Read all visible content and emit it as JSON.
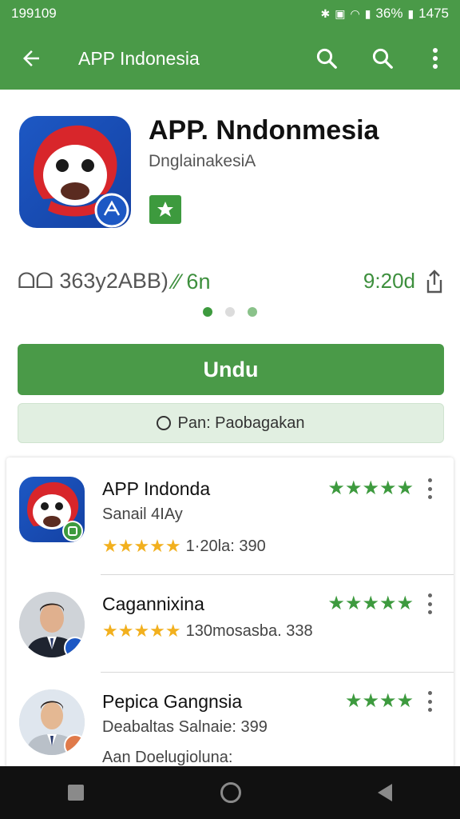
{
  "status_bar": {
    "time": "199109",
    "battery": "36%",
    "clock": "1475"
  },
  "app_bar": {
    "title": "APP Indonesia"
  },
  "app": {
    "name": "APP. Nndonmesia",
    "developer": "DnglainakesiA",
    "meta_left": "ᗝᗝ 363y2ABB)",
    "meta_green": "⁄⁄ 6n",
    "meta_right": "9:20d",
    "install_label": "Undu",
    "secondary_label": "Pan: Paobagakan"
  },
  "carousel": {
    "count": 3,
    "active": 0
  },
  "list": [
    {
      "title": "APP Indonda",
      "subtitle": "Sanail 4IAy",
      "stars": "★★★★★",
      "meta": "1·20la: 390",
      "rating_stars": "★★★★★"
    },
    {
      "title": "Cagannixina",
      "subtitle": "",
      "stars": "★★★★★",
      "meta": "130mosasba. 338",
      "rating_stars": "★★★★★"
    },
    {
      "title": "Pepica Gangnsia",
      "subtitle": "Deabaltas Salnaie: 399",
      "stars": "",
      "meta": "Aan Doelugioluna:",
      "rating_stars": "★★★★"
    }
  ],
  "colors": {
    "primary": "#4a9a48",
    "accent_star": "#f2b01e",
    "icon_blue": "#1d58c4"
  }
}
